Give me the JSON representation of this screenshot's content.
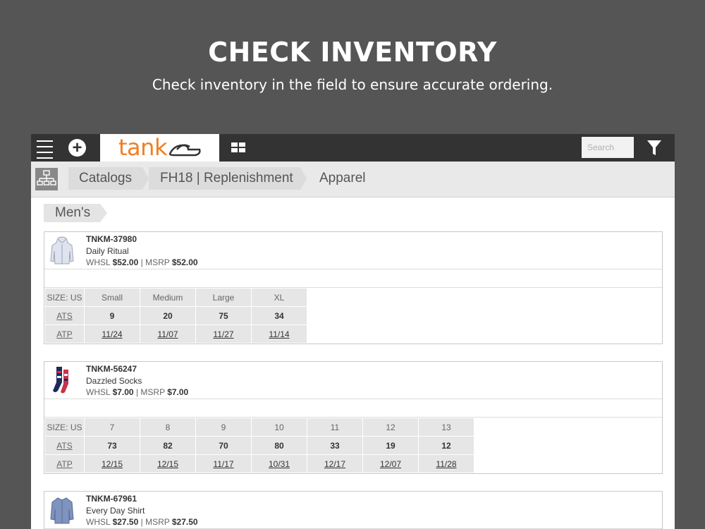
{
  "hero": {
    "title": "CHECK INVENTORY",
    "subtitle": "Check inventory in the field to ensure accurate ordering."
  },
  "toolbar": {
    "menu_icon": "hamburger-icon",
    "add_icon": "plus-circle-icon",
    "logo_text": "tank",
    "logo_icon": "tank-icon",
    "grid_icon": "grid-view-icon",
    "search_placeholder": "Search",
    "filter_icon": "funnel-icon"
  },
  "breadcrumb": {
    "tree_icon": "hierarchy-icon",
    "items": [
      "Catalogs",
      "FH18 | Replenishment",
      "Apparel"
    ]
  },
  "section": {
    "label": "Men's"
  },
  "colors": {
    "brand": "#f07f22",
    "topbar": "#333333",
    "background": "#555555"
  },
  "table_labels": {
    "size": "SIZE: US",
    "ats": "ATS",
    "atp": "ATP"
  },
  "products": [
    {
      "sku": "TNKM-37980",
      "name": "Daily Ritual",
      "whsl_label": "WHSL",
      "whsl": "$52.00",
      "msrp_label": "MSRP",
      "msrp": "$52.00",
      "thumb_icon": "hoodie-icon",
      "sizes": [
        "Small",
        "Medium",
        "Large",
        "XL"
      ],
      "ats": [
        "9",
        "20",
        "75",
        "34"
      ],
      "atp": [
        "11/24",
        "11/07",
        "11/27",
        "11/14"
      ]
    },
    {
      "sku": "TNKM-56247",
      "name": "Dazzled Socks",
      "whsl_label": "WHSL",
      "whsl": "$7.00",
      "msrp_label": "MSRP",
      "msrp": "$7.00",
      "thumb_icon": "socks-icon",
      "sizes": [
        "7",
        "8",
        "9",
        "10",
        "11",
        "12",
        "13"
      ],
      "ats": [
        "73",
        "82",
        "70",
        "80",
        "33",
        "19",
        "12"
      ],
      "atp": [
        "12/15",
        "12/15",
        "11/17",
        "10/31",
        "12/17",
        "12/07",
        "11/28"
      ]
    },
    {
      "sku": "TNKM-67961",
      "name": "Every Day Shirt",
      "whsl_label": "WHSL",
      "whsl": "$27.50",
      "msrp_label": "MSRP",
      "msrp": "$27.50",
      "thumb_icon": "shirt-icon"
    }
  ]
}
